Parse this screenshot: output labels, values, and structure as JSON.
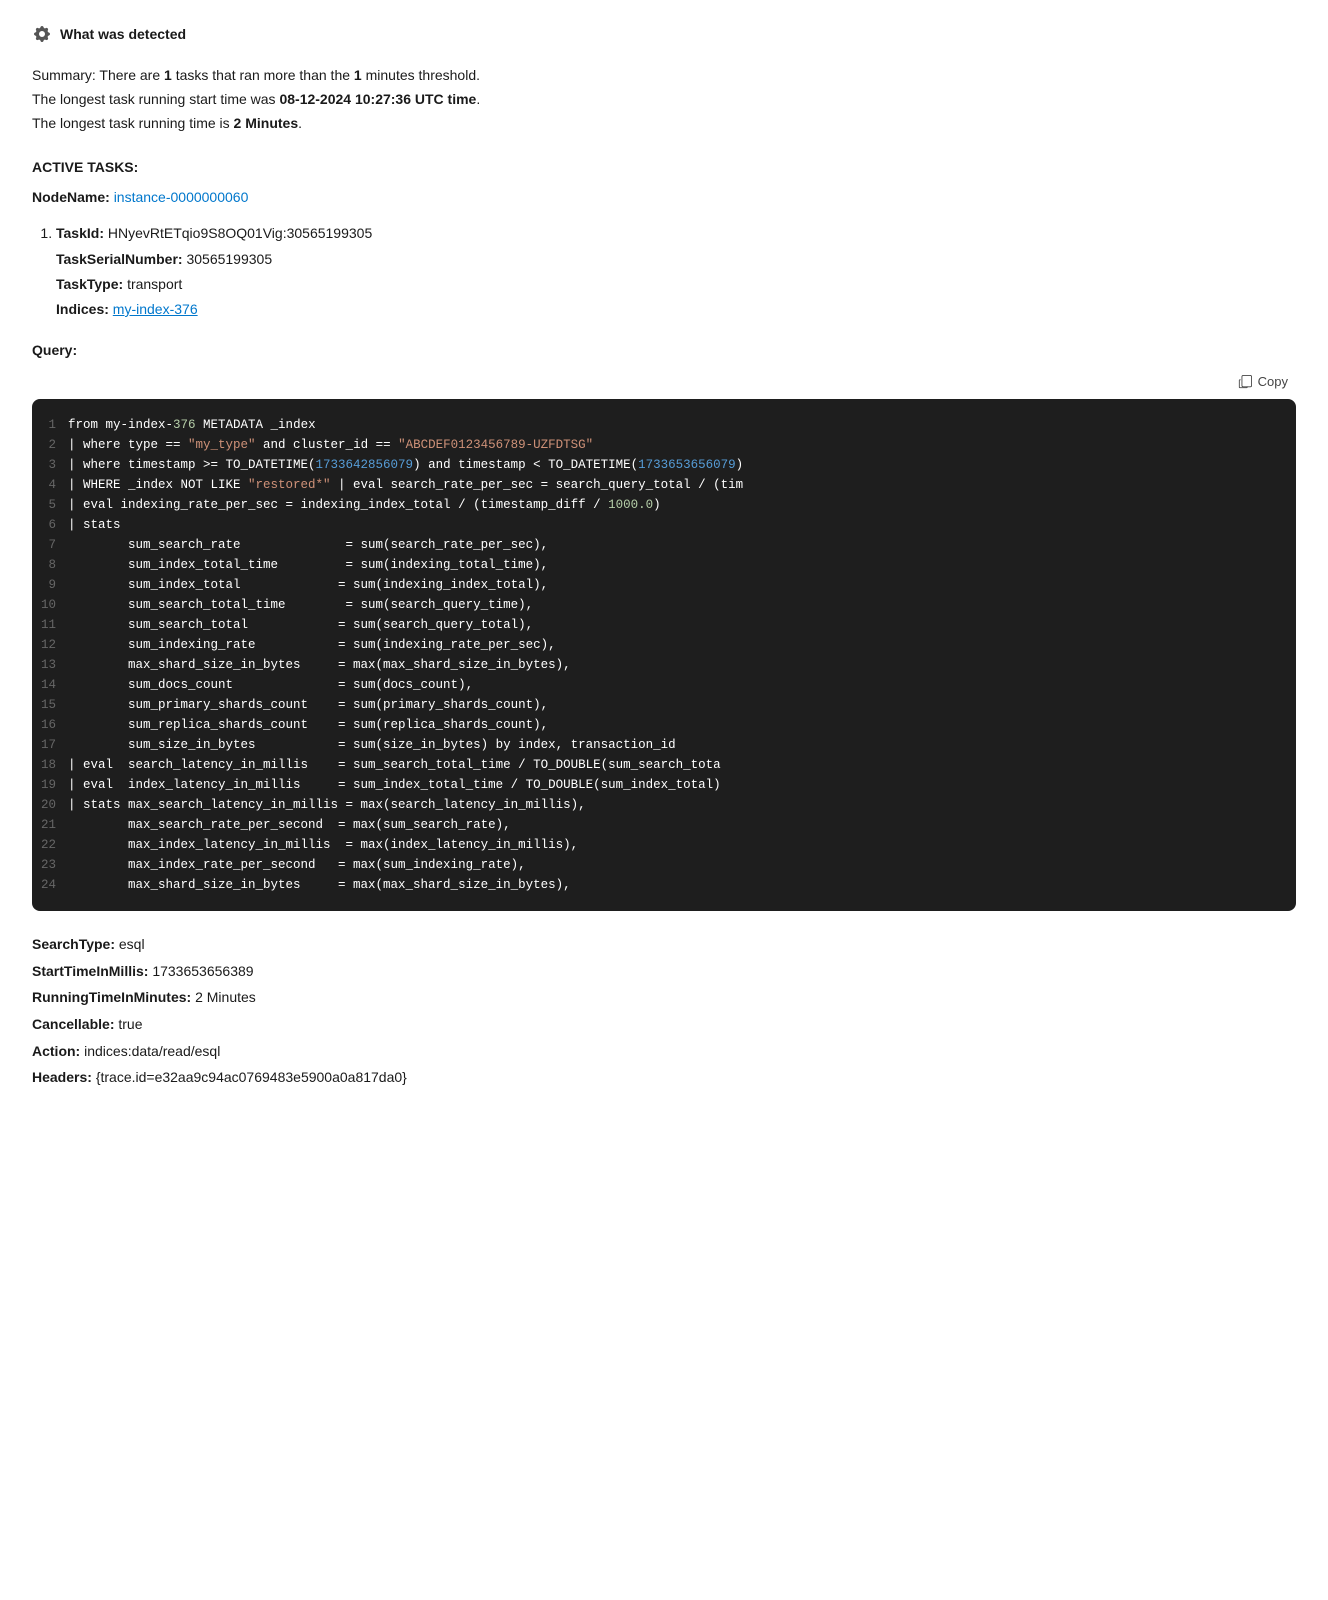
{
  "header": {
    "icon": "gear-icon",
    "title": "What was detected"
  },
  "summary": {
    "line1": "Summary: There are ",
    "tasks_count": "1",
    "line1b": " tasks that ran more than the ",
    "threshold": "1",
    "line1c": " minutes threshold.",
    "line2": "The longest task running start time was ",
    "start_time": "08-12-2024 10:27:36 UTC time",
    "line3": "The longest task running time is ",
    "running_time": "2 Minutes",
    "period": "."
  },
  "active_tasks_label": "ACTIVE TASKS:",
  "node": {
    "label": "NodeName:",
    "name": "instance-0000000060"
  },
  "task": {
    "number": "1",
    "task_id_label": "TaskId:",
    "task_id_value": "HNyevRtETqio9S8OQ01Vig:30565199305",
    "task_serial_label": "TaskSerialNumber:",
    "task_serial_value": "30565199305",
    "task_type_label": "TaskType:",
    "task_type_value": "transport",
    "indices_label": "Indices:",
    "indices_value": "my-index-376"
  },
  "query_label": "Query:",
  "copy_button_label": "Copy",
  "code_lines": [
    {
      "num": "1",
      "raw": "from my-index-376 METADATA _index"
    },
    {
      "num": "2",
      "raw": "| where type == \"my_type\" and cluster_id == \"ABCDEF0123456789-UZFDTSG\""
    },
    {
      "num": "3",
      "raw": "| where timestamp >= TO_DATETIME(1733642856079) and timestamp < TO_DATETIME(1733653656079)"
    },
    {
      "num": "4",
      "raw": "| WHERE _index NOT LIKE \"restored*\" | eval search_rate_per_sec = search_query_total / (tim"
    },
    {
      "num": "5",
      "raw": "| eval indexing_rate_per_sec = indexing_index_total / (timestamp_diff / 1000.0)"
    },
    {
      "num": "6",
      "raw": "| stats"
    },
    {
      "num": "7",
      "raw": "        sum_search_rate              = sum(search_rate_per_sec),"
    },
    {
      "num": "8",
      "raw": "        sum_index_total_time         = sum(indexing_total_time),"
    },
    {
      "num": "9",
      "raw": "        sum_index_total             = sum(indexing_index_total),"
    },
    {
      "num": "10",
      "raw": "        sum_search_total_time        = sum(search_query_time),"
    },
    {
      "num": "11",
      "raw": "        sum_search_total            = sum(search_query_total),"
    },
    {
      "num": "12",
      "raw": "        sum_indexing_rate           = sum(indexing_rate_per_sec),"
    },
    {
      "num": "13",
      "raw": "        max_shard_size_in_bytes     = max(max_shard_size_in_bytes),"
    },
    {
      "num": "14",
      "raw": "        sum_docs_count              = sum(docs_count),"
    },
    {
      "num": "15",
      "raw": "        sum_primary_shards_count    = sum(primary_shards_count),"
    },
    {
      "num": "16",
      "raw": "        sum_replica_shards_count    = sum(replica_shards_count),"
    },
    {
      "num": "17",
      "raw": "        sum_size_in_bytes           = sum(size_in_bytes) by index, transaction_id"
    },
    {
      "num": "18",
      "raw": "| eval  search_latency_in_millis    = sum_search_total_time / TO_DOUBLE(sum_search_tota"
    },
    {
      "num": "19",
      "raw": "| eval  index_latency_in_millis     = sum_index_total_time / TO_DOUBLE(sum_index_total)"
    },
    {
      "num": "20",
      "raw": "| stats max_search_latency_in_millis = max(search_latency_in_millis),"
    },
    {
      "num": "21",
      "raw": "        max_search_rate_per_second  = max(sum_search_rate),"
    },
    {
      "num": "22",
      "raw": "        max_index_latency_in_millis  = max(index_latency_in_millis),"
    },
    {
      "num": "23",
      "raw": "        max_index_rate_per_second   = max(sum_indexing_rate),"
    },
    {
      "num": "24",
      "raw": "        max_shard_size_in_bytes     = max(max_shard_size_in_bytes),"
    }
  ],
  "metadata": {
    "search_type_label": "SearchType:",
    "search_type_value": "esql",
    "start_time_label": "StartTimeInMillis:",
    "start_time_value": "1733653656389",
    "running_time_label": "RunningTimeInMinutes:",
    "running_time_value": "2 Minutes",
    "cancellable_label": "Cancellable:",
    "cancellable_value": "true",
    "action_label": "Action:",
    "action_value": "indices:data/read/esql",
    "headers_label": "Headers:",
    "headers_value": "{trace.id=e32aa9c94ac0769483e5900a0a817da0}"
  }
}
